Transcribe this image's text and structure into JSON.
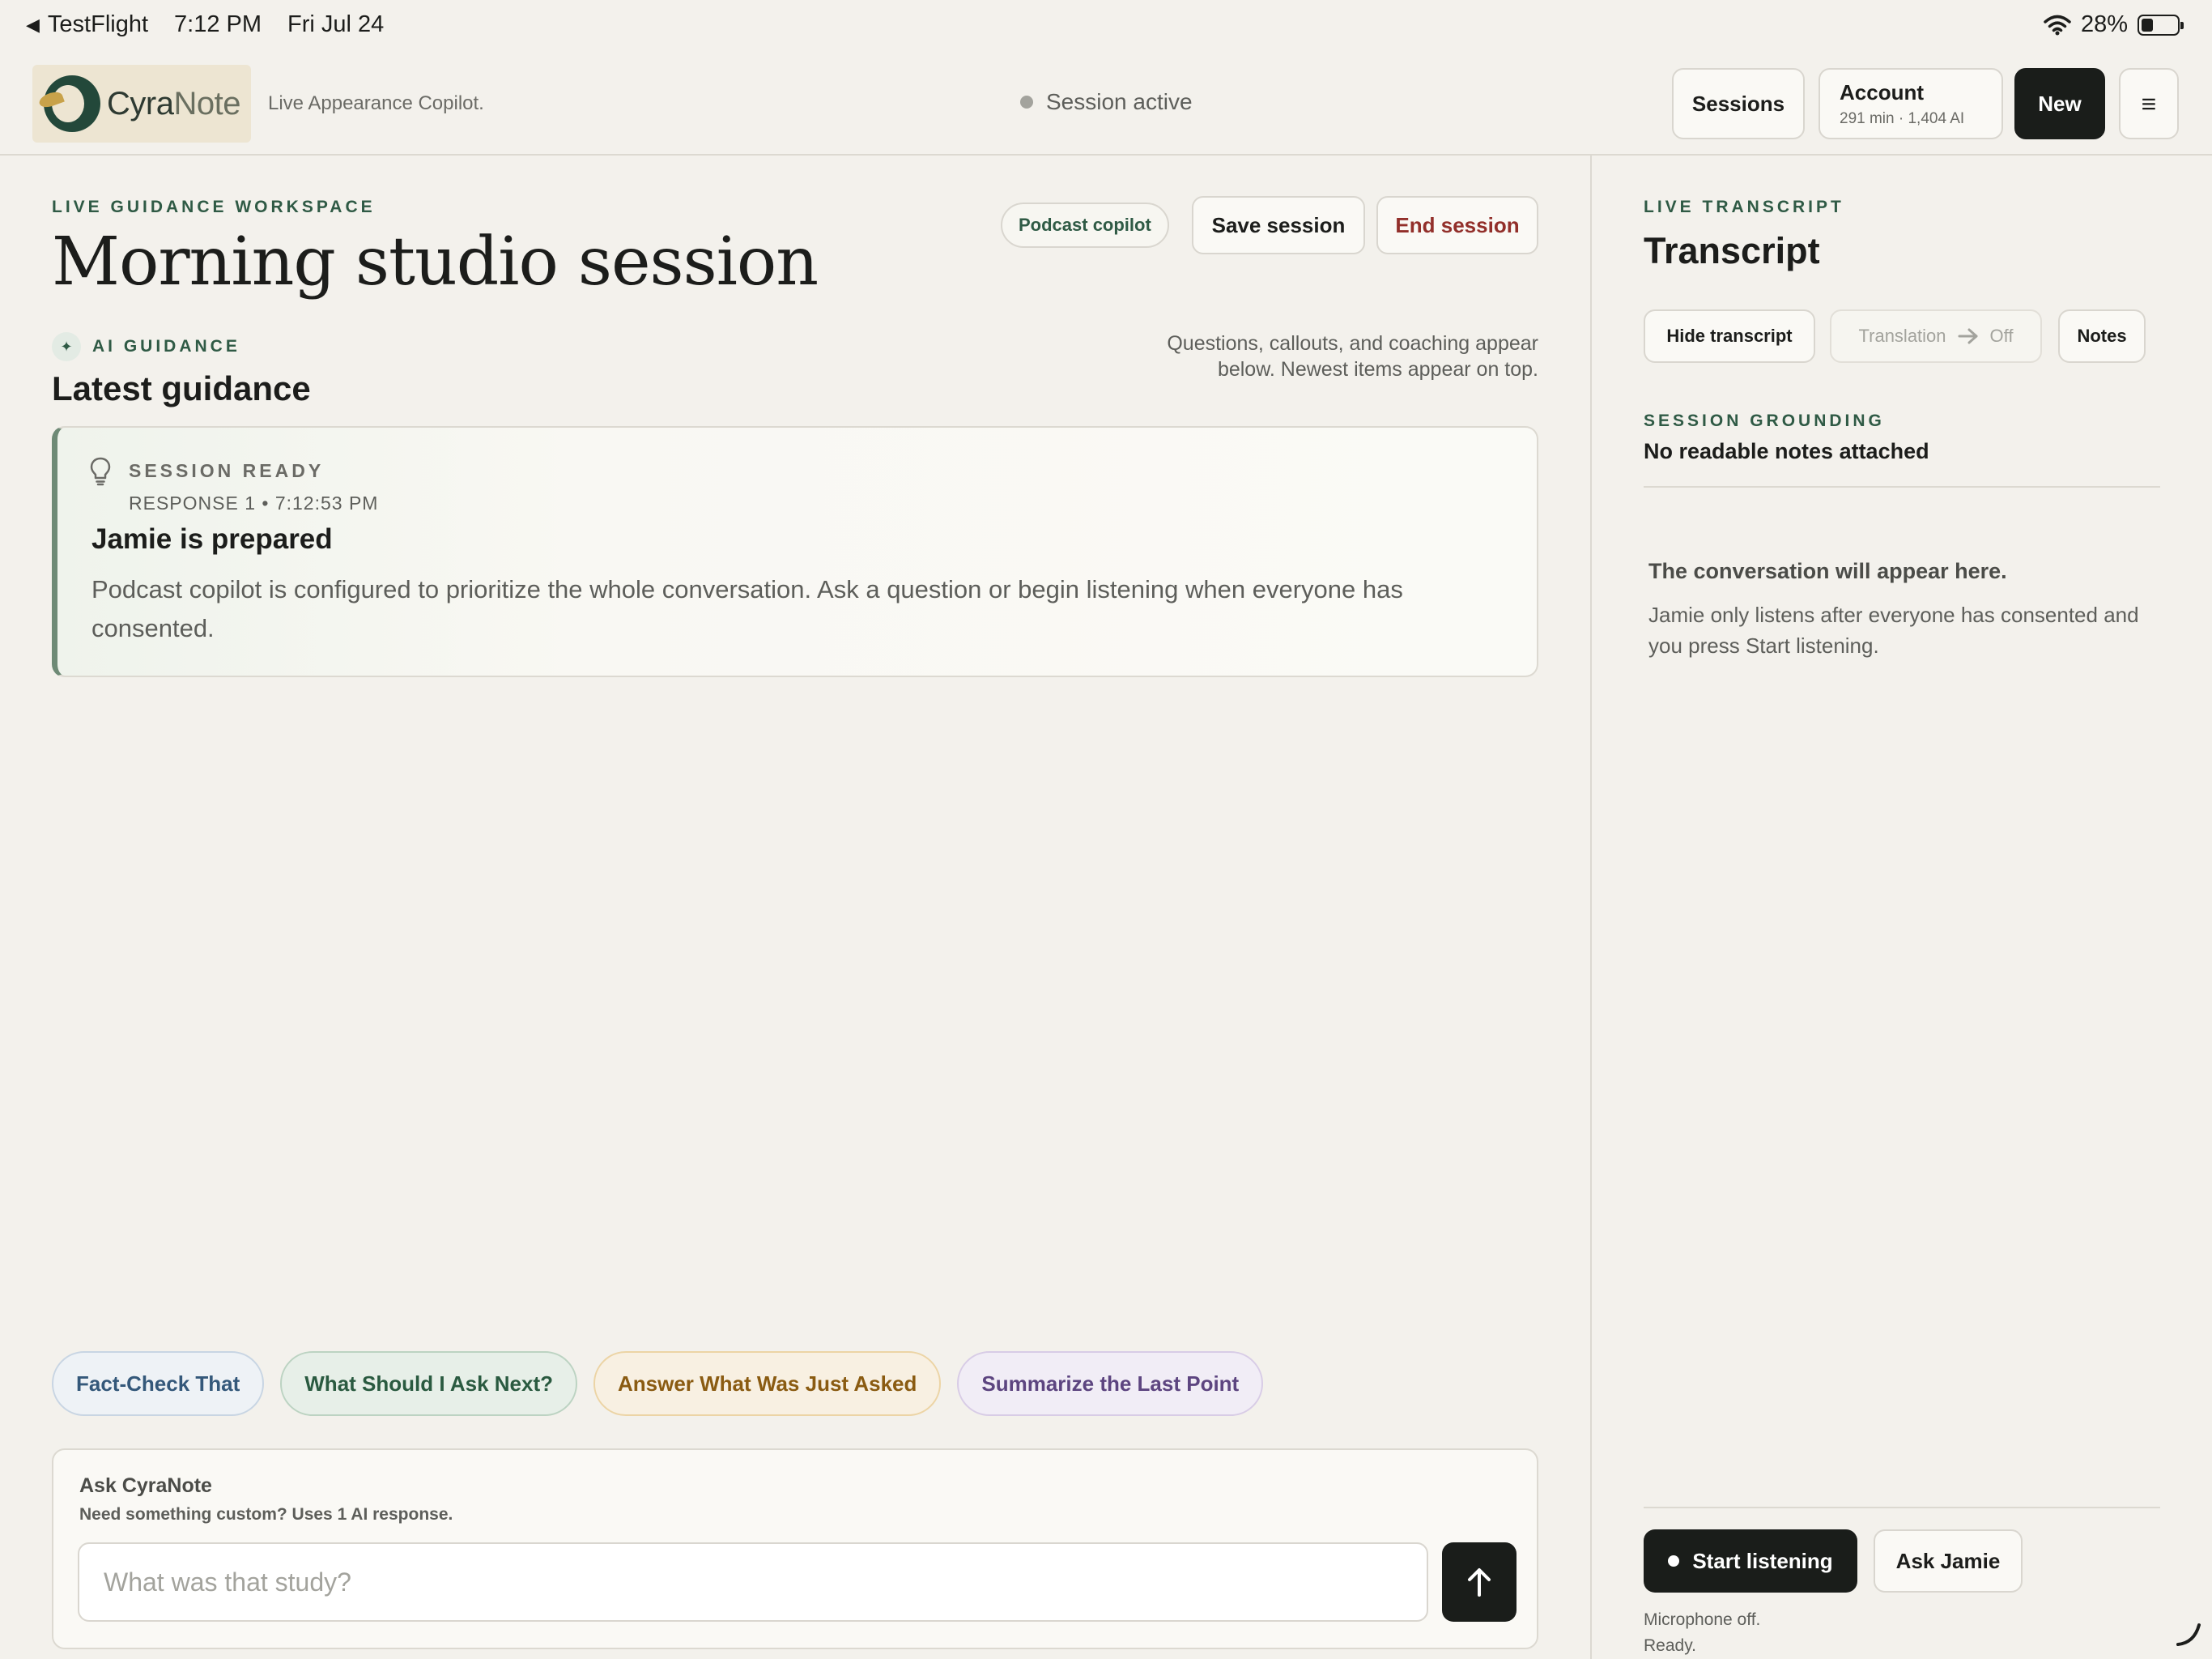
{
  "status_bar": {
    "back_app": "TestFlight",
    "time": "7:12 PM",
    "date": "Fri Jul 24",
    "battery": "28%"
  },
  "header": {
    "brand_cyra": "Cyra",
    "brand_note": "Note",
    "tagline": "Live Appearance Copilot.",
    "session_status": "Session active",
    "sessions_label": "Sessions",
    "account_label": "Account",
    "account_sub": "291 min · 1,404 AI",
    "new_label": "New",
    "menu_glyph": "≡"
  },
  "main": {
    "eyebrow": "LIVE GUIDANCE WORKSPACE",
    "title": "Morning studio session",
    "copilot_pill": "Podcast copilot",
    "save_label": "Save session",
    "end_label": "End session",
    "ai_eyebrow": "AI GUIDANCE",
    "latest_title": "Latest guidance",
    "guidance_note": "Questions, callouts, and coaching appear below. Newest items appear on top.",
    "card": {
      "label": "SESSION READY",
      "meta": "RESPONSE 1 • 7:12:53 PM",
      "title": "Jamie is prepared",
      "body": "Podcast copilot is configured to prioritize the whole conversation. Ask a question or begin listening when everyone has consented."
    },
    "chips": {
      "fact_check": "Fact-Check That",
      "ask_next": "What Should I Ask Next?",
      "answer": "Answer What Was Just Asked",
      "summarize": "Summarize the Last Point"
    },
    "ask": {
      "title": "Ask CyraNote",
      "subtitle": "Need something custom? Uses 1 AI response.",
      "placeholder": "What was that study?",
      "value": ""
    }
  },
  "sidebar": {
    "eyebrow": "LIVE TRANSCRIPT",
    "title": "Transcript",
    "hide_label": "Hide transcript",
    "translation_label": "Translation",
    "translation_value": "Off",
    "notes_label": "Notes",
    "grounding_eyebrow": "SESSION GROUNDING",
    "grounding_value": "No readable notes attached",
    "empty_title": "The conversation will appear here.",
    "empty_body": "Jamie only listens after everyone has consented and you press Start listening.",
    "start_label": "Start listening",
    "ask_jamie_label": "Ask Jamie",
    "mic_status": "Microphone off.",
    "ready_status": "Ready."
  },
  "colors": {
    "background": "#f3f1ec",
    "accent_green": "#2f5a45",
    "danger": "#922f2a",
    "primary_dark": "#1a1d1a"
  },
  "icons": [
    "back-arrow-icon",
    "wifi-icon",
    "battery-icon",
    "menu-icon",
    "sparkle-icon",
    "lightbulb-icon",
    "arrow-right-icon",
    "send-arrow-up-icon",
    "resize-handle-icon"
  ]
}
